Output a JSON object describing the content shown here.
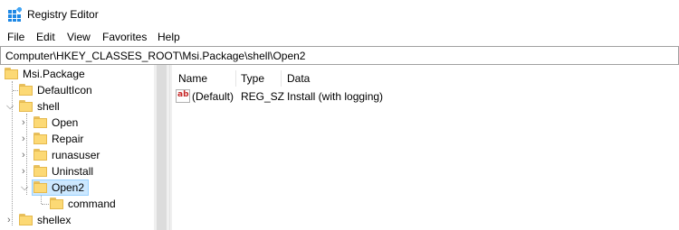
{
  "window": {
    "title": "Registry Editor",
    "icon": "registry-editor-icon"
  },
  "menu": [
    "File",
    "Edit",
    "View",
    "Favorites",
    "Help"
  ],
  "address": {
    "path": "Computer\\HKEY_CLASSES_ROOT\\Msi.Package\\shell\\Open2"
  },
  "tree": {
    "root": "Msi.Package",
    "items": [
      "DefaultIcon",
      "shell",
      "Open",
      "Repair",
      "runasuser",
      "Uninstall",
      "Open2",
      "command",
      "shellex"
    ],
    "selected": "Open2"
  },
  "list": {
    "columns": [
      "Name",
      "Type",
      "Data"
    ],
    "rows": [
      {
        "name": "(Default)",
        "type": "REG_SZ",
        "data": "Install (with logging)",
        "icon": "string-value-icon"
      }
    ]
  },
  "colors": {
    "folder": "#fcd975",
    "selection": "#cce8ff",
    "accent": "#0078d7"
  }
}
